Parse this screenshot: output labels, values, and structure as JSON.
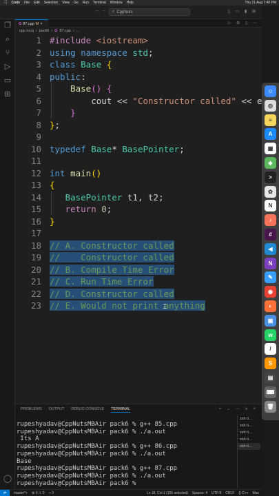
{
  "menubar": {
    "app_name": "Code",
    "items": [
      "File",
      "Edit",
      "Selection",
      "View",
      "Go",
      "Run",
      "Terminal",
      "Window",
      "Help"
    ],
    "clock": "Thu 21 Aug 7:40 PM"
  },
  "titlebar": {
    "search_text": "CppNuts"
  },
  "tab": {
    "filename": "87.cpp",
    "lang_badge": "G",
    "modified": "M",
    "close": "×"
  },
  "breadcrumb": {
    "parts": [
      "cpp mcq",
      "pack6",
      "87.cpp",
      "..."
    ],
    "lang_badge": "G"
  },
  "editor": {
    "lines": [
      {
        "n": "1",
        "tokens": [
          [
            "pp",
            "#include "
          ],
          [
            "st",
            "<iostream>"
          ]
        ]
      },
      {
        "n": "2",
        "tokens": [
          [
            "kw",
            "using namespace "
          ],
          [
            "ty",
            "std"
          ],
          [
            "pl",
            ";"
          ]
        ]
      },
      {
        "n": "3",
        "tokens": [
          [
            "kw",
            "class "
          ],
          [
            "ty",
            "Base "
          ],
          [
            "br1",
            "{"
          ]
        ]
      },
      {
        "n": "4",
        "tokens": [
          [
            "kw",
            "public"
          ],
          [
            "pl",
            ":"
          ]
        ]
      },
      {
        "n": "5",
        "tokens": [
          [
            "pl",
            "    "
          ],
          [
            "fn",
            "Base"
          ],
          [
            "br2",
            "() {"
          ]
        ]
      },
      {
        "n": "6",
        "tokens": [
          [
            "pl",
            "        cout << "
          ],
          [
            "st",
            "\"Constructor called\""
          ],
          [
            "pl",
            " << endl;"
          ]
        ]
      },
      {
        "n": "7",
        "tokens": [
          [
            "pl",
            "    "
          ],
          [
            "br2",
            "}"
          ]
        ]
      },
      {
        "n": "8",
        "tokens": [
          [
            "br1",
            "}"
          ],
          [
            "pl",
            ";"
          ]
        ]
      },
      {
        "n": "9",
        "tokens": []
      },
      {
        "n": "10",
        "tokens": [
          [
            "kw",
            "typedef "
          ],
          [
            "ty",
            "Base"
          ],
          [
            "pl",
            "* "
          ],
          [
            "ty",
            "BasePointer"
          ],
          [
            "pl",
            ";"
          ]
        ]
      },
      {
        "n": "11",
        "tokens": []
      },
      {
        "n": "12",
        "tokens": [
          [
            "kw",
            "int "
          ],
          [
            "fn",
            "main"
          ],
          [
            "br1",
            "()"
          ]
        ]
      },
      {
        "n": "13",
        "tokens": [
          [
            "br1",
            "{"
          ]
        ]
      },
      {
        "n": "14",
        "tokens": [
          [
            "pl",
            "   "
          ],
          [
            "ty",
            "BasePointer"
          ],
          [
            "pl",
            " t1, t2;"
          ]
        ]
      },
      {
        "n": "15",
        "tokens": [
          [
            "pl",
            "   "
          ],
          [
            "pp",
            "return "
          ],
          [
            "nm",
            "0"
          ],
          [
            "pl",
            ";"
          ]
        ]
      },
      {
        "n": "16",
        "tokens": [
          [
            "br1",
            "}"
          ]
        ]
      },
      {
        "n": "17",
        "tokens": []
      },
      {
        "n": "18",
        "sel": true,
        "tokens": [
          [
            "cm",
            "// A. Constructor called"
          ]
        ]
      },
      {
        "n": "19",
        "sel": true,
        "tokens": [
          [
            "cm",
            "//    Constructor called"
          ]
        ]
      },
      {
        "n": "20",
        "sel": true,
        "tokens": [
          [
            "cm",
            "// B. Compile Time Error"
          ]
        ]
      },
      {
        "n": "21",
        "sel": true,
        "tokens": [
          [
            "cm",
            "// C. Run Time Error"
          ]
        ]
      },
      {
        "n": "22",
        "sel": true,
        "tokens": [
          [
            "cm",
            "// D. Constructor called"
          ]
        ]
      },
      {
        "n": "23",
        "sel": true,
        "tokens": [
          [
            "cm",
            "// E. Would not print anything"
          ]
        ]
      }
    ]
  },
  "panel": {
    "tabs": [
      "PROBLEMS",
      "OUTPUT",
      "DEBUG CONSOLE",
      "TERMINAL"
    ],
    "active_tab": "TERMINAL",
    "terminal_lines": [
      "rupeshyadav@CppNutsMBAir pack6 % g++ 85.cpp",
      "rupeshyadav@CppNutsMBAir pack6 % ./a.out",
      " Its A",
      "rupeshyadav@CppNutsMBAir pack6 % g++ 86.cpp",
      "rupeshyadav@CppNutsMBAir pack6 % ./a.out",
      "Base",
      "rupeshyadav@CppNutsMBAir pack6 % g++ 87.cpp",
      "rupeshyadav@CppNutsMBAir pack6 % ./a.out",
      "rupeshyadav@CppNutsMBAir pack6 % "
    ],
    "terminal_list": [
      "zsh  ti…",
      "zsh  ti…",
      "zsh  ti…",
      "zsh  ti…",
      "zsh  ti…"
    ]
  },
  "statusbar": {
    "branch": "master*+",
    "problems": "⊗ 0 ⚠ 0",
    "ports": "⌁ 0",
    "position": "Ln 18, Col 1 (155 selected)",
    "spaces": "Spaces: 4",
    "encoding": "UTF-8",
    "eol": "CRLF",
    "language": "{} C++",
    "platform": "Mac"
  },
  "dock_apps": [
    {
      "name": "finder-app",
      "color": "#3d8bfd",
      "glyph": "☺"
    },
    {
      "name": "chrome-app",
      "color": "#dddddd",
      "glyph": "◎"
    },
    {
      "name": "notes-app",
      "color": "#f6d55c",
      "glyph": "≡"
    },
    {
      "name": "app-store-app",
      "color": "#1a8cff",
      "glyph": "A"
    },
    {
      "name": "calendar-app",
      "color": "#ffffff",
      "glyph": "▦"
    },
    {
      "name": "maps-app",
      "color": "#5cb85c",
      "glyph": "◈"
    },
    {
      "name": "terminal-app",
      "color": "#222222",
      "glyph": ">"
    },
    {
      "name": "photos-app",
      "color": "#e8e8e8",
      "glyph": "✿"
    },
    {
      "name": "notion-app",
      "color": "#ffffff",
      "glyph": "N"
    },
    {
      "name": "music-app",
      "color": "#f5735a",
      "glyph": "♪"
    },
    {
      "name": "slack-app",
      "color": "#4a154b",
      "glyph": "#"
    },
    {
      "name": "vscode-app",
      "color": "#1f8ad2",
      "glyph": "◀"
    },
    {
      "name": "onenote-app",
      "color": "#7b3fbf",
      "glyph": "N"
    },
    {
      "name": "preview-app",
      "color": "#3aa0ff",
      "glyph": "✎"
    },
    {
      "name": "chrome2-app",
      "color": "#e94235",
      "glyph": "◉"
    },
    {
      "name": "firefox-app",
      "color": "#ff7139",
      "glyph": "◐"
    },
    {
      "name": "gallery-app",
      "color": "#4a90e2",
      "glyph": "▣"
    },
    {
      "name": "whatsapp-app",
      "color": "#25d366",
      "glyph": "w"
    },
    {
      "name": "pen-app",
      "color": "#ffffff",
      "glyph": "/"
    },
    {
      "name": "sublime-app",
      "color": "#ff9800",
      "glyph": "S"
    },
    {
      "name": "scripts-app",
      "color": "#444444",
      "glyph": "▤"
    },
    {
      "name": "keyboard-app",
      "color": "#666666",
      "glyph": "⌨"
    },
    {
      "name": "trash-app",
      "color": "#888888",
      "glyph": "🗑"
    }
  ]
}
